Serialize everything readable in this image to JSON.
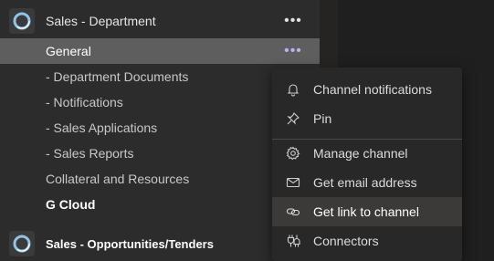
{
  "teams": [
    {
      "name": "Sales - Department",
      "more": "•••"
    },
    {
      "name": "Sales - Opportunities/Tenders",
      "more": ""
    }
  ],
  "channels": [
    {
      "label": "General",
      "more": "•••"
    },
    {
      "label": "- Department Documents"
    },
    {
      "label": "- Notifications"
    },
    {
      "label": "- Sales Applications"
    },
    {
      "label": "- Sales Reports"
    },
    {
      "label": "Collateral and Resources"
    },
    {
      "label": "G Cloud"
    }
  ],
  "context_menu": {
    "items": [
      {
        "label": "Channel notifications",
        "icon": "bell-icon"
      },
      {
        "label": "Pin",
        "icon": "pin-icon"
      },
      {
        "label": "Manage channel",
        "icon": "gear-icon"
      },
      {
        "label": "Get email address",
        "icon": "envelope-icon"
      },
      {
        "label": "Get link to channel",
        "icon": "link-icon"
      },
      {
        "label": "Connectors",
        "icon": "connectors-icon"
      }
    ]
  },
  "colors": {
    "selected_row": "#5e5e5e",
    "menu_bg": "#292828",
    "menu_hover": "#3b3a39",
    "accent_dots": "#b6b4ee"
  }
}
